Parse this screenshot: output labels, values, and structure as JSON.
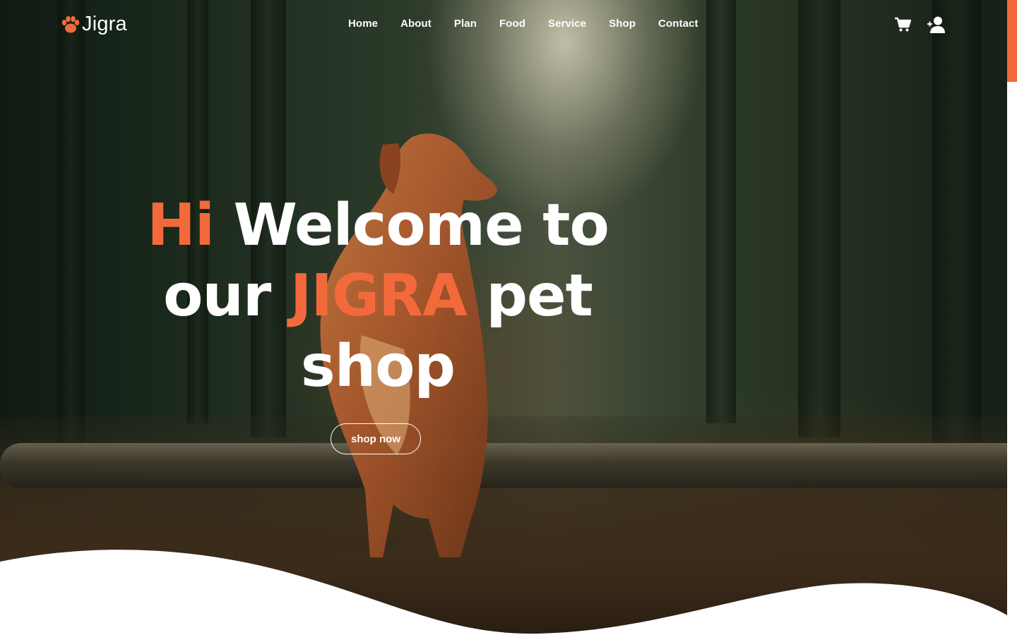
{
  "brand": {
    "name": "Jigra",
    "accent_color": "#f26a3b"
  },
  "nav": {
    "items": [
      {
        "label": "Home"
      },
      {
        "label": "About"
      },
      {
        "label": "Plan"
      },
      {
        "label": "Food"
      },
      {
        "label": "Service"
      },
      {
        "label": "Shop"
      },
      {
        "label": "Contact"
      }
    ]
  },
  "header_icons": {
    "cart": "cart-icon",
    "user": "add-user-icon"
  },
  "hero": {
    "headline_part1": "Hi",
    "headline_part2": " Welcome to our ",
    "headline_part3": "JIGRA",
    "headline_part4": " pet shop",
    "button_label": "shop now",
    "background": "dog in a forest photo"
  }
}
